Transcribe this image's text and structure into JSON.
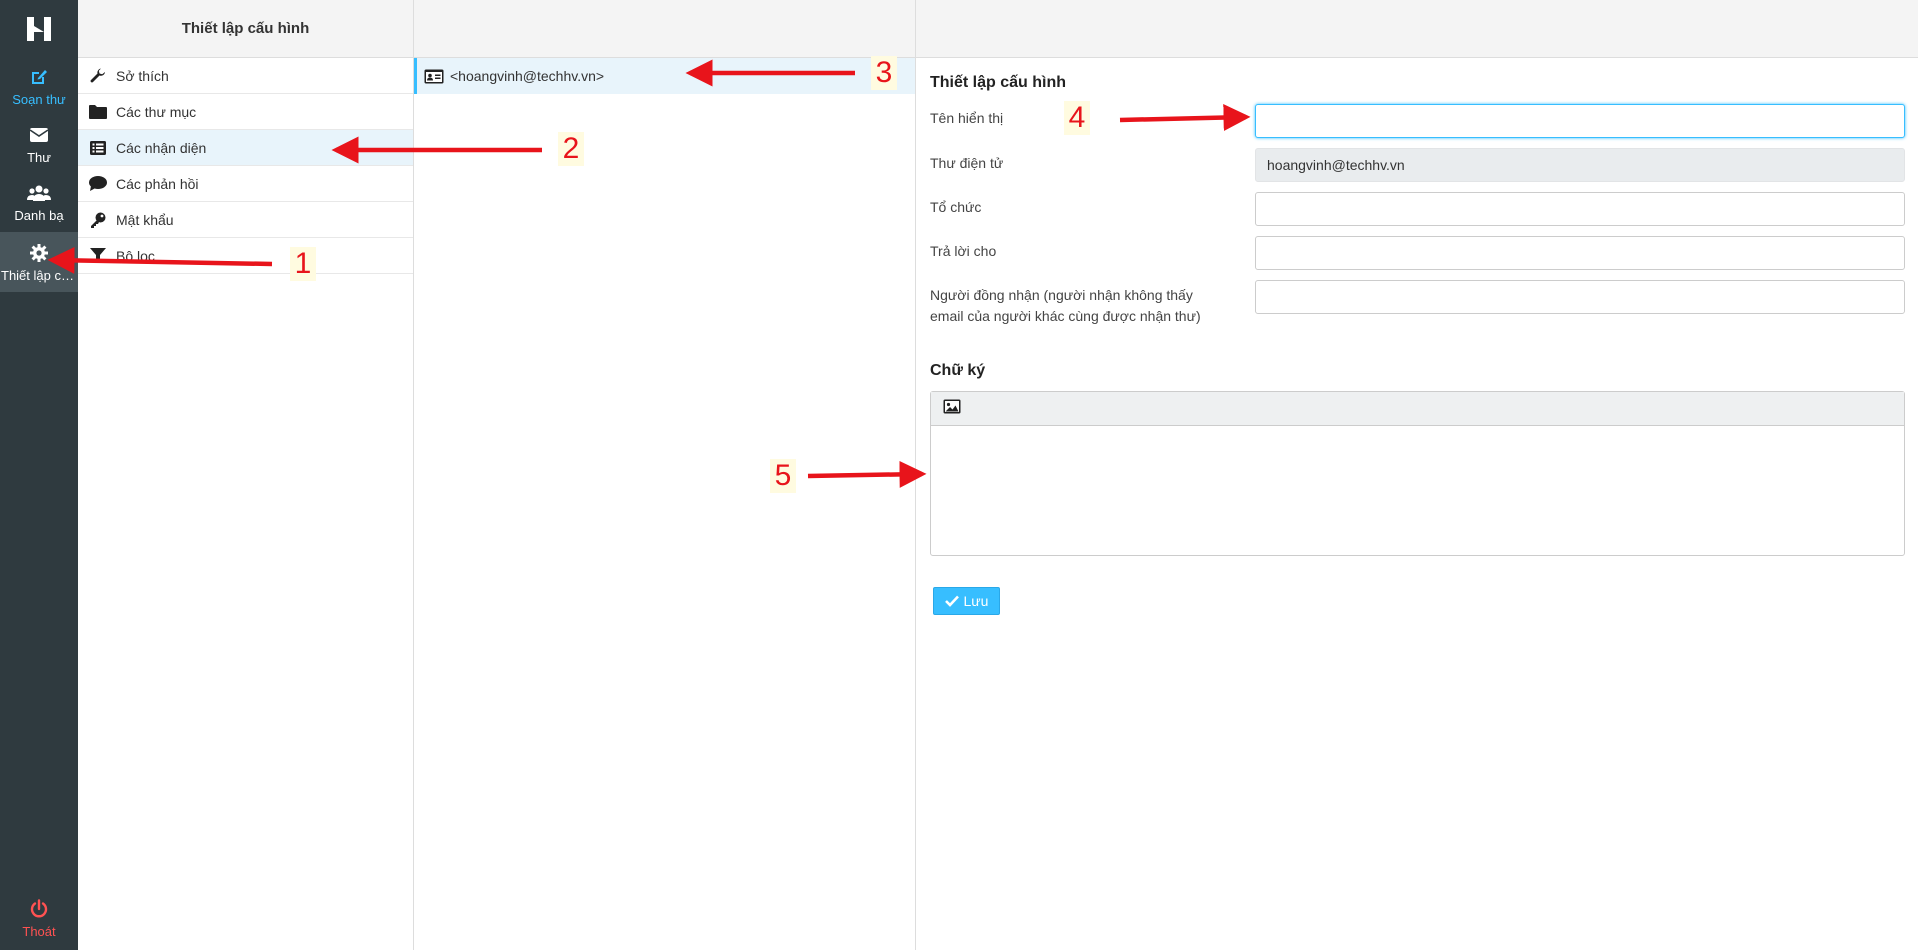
{
  "rail": {
    "compose": "Soạn thư",
    "mail": "Thư",
    "contacts": "Danh bạ",
    "settings": "Thiết lập cấ...",
    "logout": "Thoát"
  },
  "settings_panel": {
    "title": "Thiết lập cấu hình",
    "sections": [
      {
        "label": "Sở thích",
        "icon": "wrench-icon"
      },
      {
        "label": "Các thư mục",
        "icon": "folder-icon"
      },
      {
        "label": "Các nhận diện",
        "icon": "id-list-icon"
      },
      {
        "label": "Các phản hồi",
        "icon": "comment-icon"
      },
      {
        "label": "Mật khẩu",
        "icon": "key-icon"
      },
      {
        "label": "Bộ lọc",
        "icon": "filter-icon"
      }
    ]
  },
  "identities": {
    "items": [
      "<hoangvinh@techhv.vn>"
    ]
  },
  "form": {
    "title": "Thiết lập cấu hình",
    "display_name_label": "Tên hiển thị",
    "display_name_value": "",
    "email_label": "Thư điện tử",
    "email_value": "hoangvinh@techhv.vn",
    "organization_label": "Tổ chức",
    "organization_value": "",
    "reply_to_label": "Trả lời cho",
    "reply_to_value": "",
    "bcc_label": "Người đồng nhận (người nhận không thấy email của người khác cùng được nhận thư)",
    "bcc_value": "",
    "signature_title": "Chữ ký",
    "save_label": "Lưu"
  },
  "annotations": [
    "1",
    "2",
    "3",
    "4",
    "5"
  ],
  "colors": {
    "accent": "#37beff",
    "rail_bg": "#2f3a3f",
    "logout": "#ff5252",
    "annotation": "#e8141b"
  }
}
